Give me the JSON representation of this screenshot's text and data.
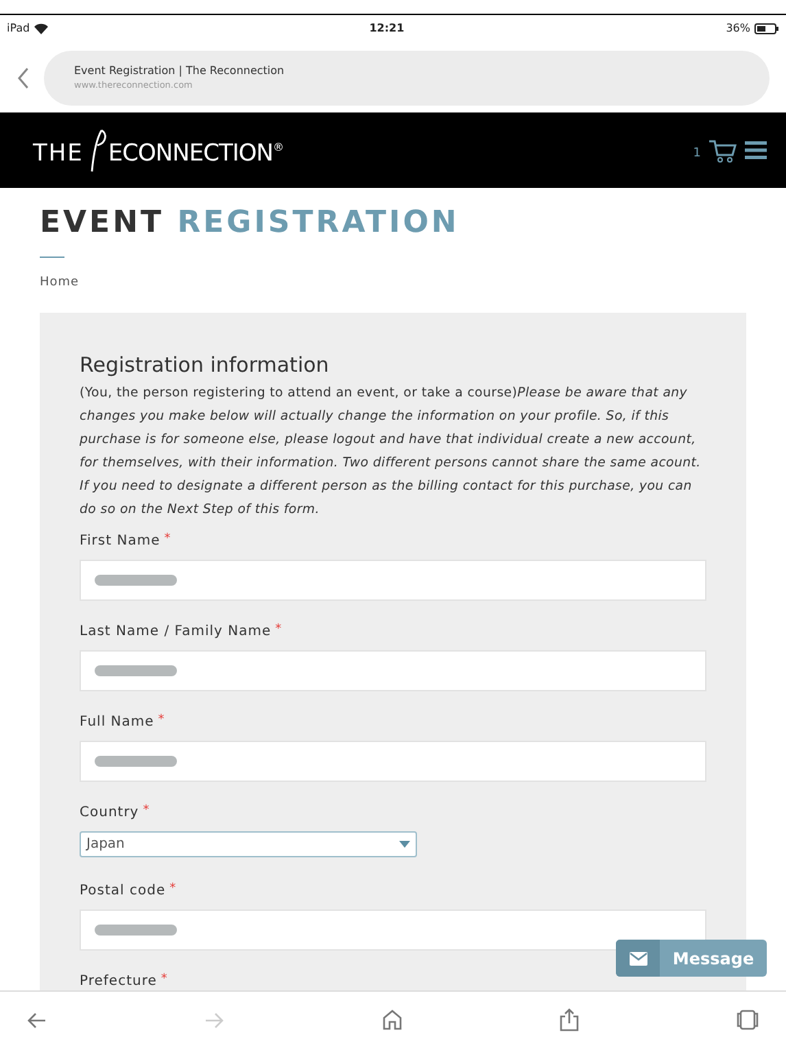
{
  "status_bar": {
    "device": "iPad",
    "time": "12:21",
    "battery": "36%"
  },
  "address_bar": {
    "title": "Event Registration | The Reconnection",
    "url": "www.thereconnection.com"
  },
  "header": {
    "logo_left": "THE",
    "logo_right": "ECONNECTION",
    "logo_mark": "®",
    "cart_count": "1"
  },
  "page_title": {
    "dark": "EVENT",
    "accent": "REGISTRATION"
  },
  "breadcrumb": "Home",
  "section": {
    "title": "Registration information",
    "intro": "(You, the person registering to attend an event, or take a course)*Please be aware that any changes you make below will actually change the information on your profile. So, if this purchase is for someone else, please logout and have that individual create a new account, for themselves, with their information. Two different persons cannot share the same acount. If you need to designate a different person as the billing contact for this purchase, you can do so on the Next Step of this form.*"
  },
  "fields": [
    {
      "kind": "text",
      "label": "First Name",
      "required_mark": "*",
      "redacted": true
    },
    {
      "kind": "text",
      "label": "Last Name / Family Name",
      "required_mark": "*",
      "redacted": true
    },
    {
      "kind": "text",
      "label": "Full Name",
      "required_mark": "*",
      "redacted": true
    },
    {
      "kind": "select",
      "label": "Country",
      "required_mark": "*",
      "value": "Japan"
    },
    {
      "kind": "text",
      "label": "Postal code",
      "required_mark": "*",
      "redacted": true
    },
    {
      "kind": "cut",
      "label": "Prefecture",
      "required_mark": "*"
    }
  ],
  "message_button": "Message"
}
